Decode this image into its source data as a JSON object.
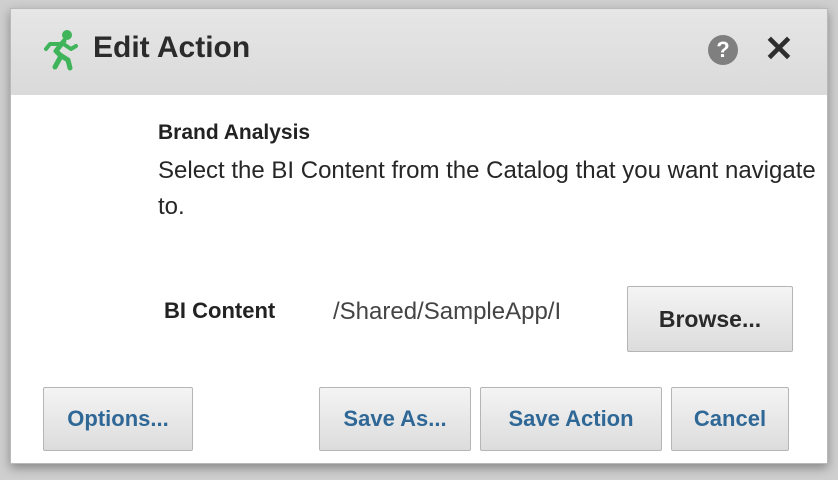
{
  "dialog": {
    "title": "Edit Action",
    "icons": {
      "title": "running-man-icon",
      "help": "help-icon",
      "close": "close-icon"
    },
    "help_glyph": "?",
    "close_glyph": "✕"
  },
  "content": {
    "heading": "Brand Analysis",
    "description": "Select the BI Content from the Catalog that you want navigate to.",
    "field": {
      "label": "BI Content",
      "value": "/Shared/SampleApp/I"
    },
    "browse_label": "Browse..."
  },
  "footer": {
    "options_label": "Options...",
    "save_as_label": "Save As...",
    "save_action_label": "Save Action",
    "cancel_label": "Cancel"
  },
  "colors": {
    "accent": "#2f6896",
    "icon_green": "#3fb45a",
    "titlebar": "#dedede"
  }
}
